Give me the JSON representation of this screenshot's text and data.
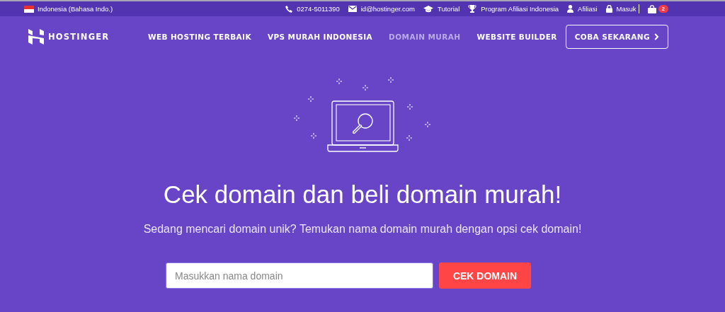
{
  "top_bar": {
    "language": "Indonesia (Bahasa Indo.)",
    "links": [
      {
        "kind": "phone",
        "label": "0274-5011390"
      },
      {
        "kind": "mail",
        "label": "id@hostinger.com"
      },
      {
        "kind": "cap",
        "label": "Tutorial"
      },
      {
        "kind": "trophy",
        "label": "Program Afiliasi Indonesia"
      },
      {
        "kind": "user",
        "label": "Afiliasi"
      },
      {
        "kind": "lock",
        "label": "Masuk"
      }
    ],
    "cart_count": "2"
  },
  "nav": {
    "logo": "HOSTINGER",
    "items": [
      {
        "label": "WEB HOSTING TERBAIK",
        "selected": false
      },
      {
        "label": "VPS MURAH INDONESIA",
        "selected": false
      },
      {
        "label": "DOMAIN MURAH",
        "selected": true
      },
      {
        "label": "WEBSITE BUILDER",
        "selected": false
      }
    ],
    "cta": "COBA SEKARANG"
  },
  "hero": {
    "title": "Cek domain dan beli domain murah!",
    "subtitle": "Sedang mencari domain unik? Temukan nama domain murah dengan opsi cek domain!"
  },
  "search": {
    "placeholder": "Masukkan nama domain",
    "button": "CEK DOMAIN"
  }
}
